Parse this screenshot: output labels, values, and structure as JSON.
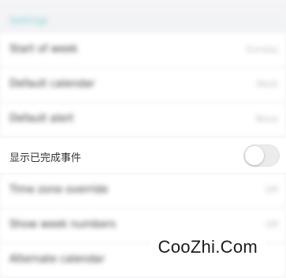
{
  "section": {
    "header": "Settings",
    "rows": [
      {
        "label": "Start of week",
        "value": "Sunday"
      },
      {
        "label": "Default calendar",
        "value": "Work"
      },
      {
        "label": "Default alert",
        "value": "None"
      },
      {
        "label": "显示已完成事件",
        "toggle": false
      },
      {
        "label": "Time zone override",
        "value": "Off"
      },
      {
        "label": "Show week numbers",
        "value": "Off"
      },
      {
        "label": "Alternate calendar",
        "value": ""
      }
    ]
  },
  "watermark": "CooZhi.Com"
}
